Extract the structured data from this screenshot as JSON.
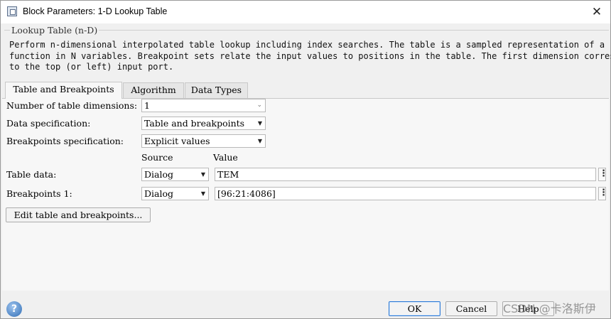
{
  "window": {
    "title": "Block Parameters: 1-D Lookup Table",
    "icon": "block-dialog-icon",
    "close_label": "✕"
  },
  "group": {
    "legend": "Lookup Table (n-D)",
    "description": "Perform n-dimensional interpolated table lookup including index searches. The table is a sampled representation of a\nfunction in N variables. Breakpoint sets relate the input values to positions in the table. The first dimension corresponds\nto the top (or left) input port."
  },
  "tabs": [
    {
      "label": "Table and Breakpoints",
      "active": true
    },
    {
      "label": "Algorithm",
      "active": false
    },
    {
      "label": "Data Types",
      "active": false
    }
  ],
  "form": {
    "num_dims_label": "Number of table dimensions:",
    "num_dims_value": "1",
    "data_spec_label": "Data specification:",
    "data_spec_value": "Table and breakpoints",
    "bp_spec_label": "Breakpoints specification:",
    "bp_spec_value": "Explicit values",
    "source_header": "Source",
    "value_header": "Value",
    "rows": [
      {
        "label": "Table data:",
        "source": "Dialog",
        "value": "TEM"
      },
      {
        "label": "Breakpoints 1:",
        "source": "Dialog",
        "value": "[96:21:4086]"
      }
    ],
    "edit_button": "Edit table and breakpoints..."
  },
  "footer": {
    "ok_label": "OK",
    "cancel_label": "Cancel",
    "help_label": "Help",
    "help_icon": "question-mark-icon"
  },
  "watermark": "CSDN @卡洛斯伊"
}
